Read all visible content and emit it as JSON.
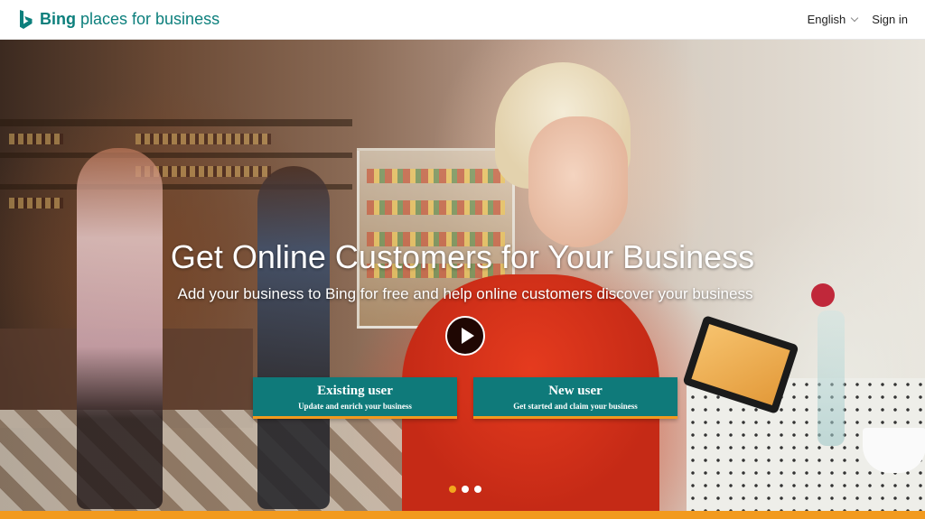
{
  "header": {
    "brand_bold": "Bing",
    "brand_rest": " places for business",
    "language_label": "English",
    "signin_label": "Sign in"
  },
  "hero": {
    "headline": "Get Online Customers for Your Business",
    "subheadline": "Add your business to Bing for free and help online customers discover your business",
    "play_icon": "play-icon",
    "existing_user": {
      "title": "Existing user",
      "subtitle": "Update and enrich your business"
    },
    "new_user": {
      "title": "New user",
      "subtitle": "Get started and claim your business"
    },
    "carousel": {
      "slide_count": 3,
      "active_index": 0
    }
  },
  "colors": {
    "brand_teal": "#0f7a7a",
    "accent_orange": "#f29a1e",
    "logo_teal": "#0c7f7c"
  },
  "icons": [
    "bing-logo-icon",
    "chevron-down-icon",
    "play-icon"
  ]
}
